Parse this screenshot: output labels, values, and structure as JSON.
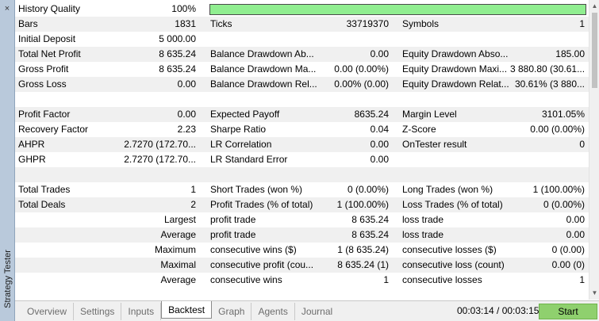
{
  "panel": {
    "title": "Strategy Tester",
    "close_glyph": "×"
  },
  "history_quality": {
    "label": "History Quality",
    "value": "100%",
    "bar_fill_percent": 100,
    "bar_color": "#90ee90"
  },
  "rows": {
    "r1": {
      "c1l": "Bars",
      "c1v": "1831",
      "c2l": "Ticks",
      "c2v": "33719370",
      "c3l": "Symbols",
      "c3v": "1"
    },
    "r2": {
      "c1l": "Initial Deposit",
      "c1v": "5 000.00"
    },
    "r3": {
      "c1l": "Total Net Profit",
      "c1v": "8 635.24",
      "c2l": "Balance Drawdown Ab...",
      "c2v": "0.00",
      "c3l": "Equity Drawdown Abso...",
      "c3v": "185.00"
    },
    "r4": {
      "c1l": "Gross Profit",
      "c1v": "8 635.24",
      "c2l": "Balance Drawdown Ma...",
      "c2v": "0.00 (0.00%)",
      "c3l": "Equity Drawdown Maxi...",
      "c3v": "3 880.80 (30.61..."
    },
    "r5": {
      "c1l": "Gross Loss",
      "c1v": "0.00",
      "c2l": "Balance Drawdown Rel...",
      "c2v": "0.00% (0.00)",
      "c3l": "Equity Drawdown Relat...",
      "c3v": "30.61% (3 880..."
    },
    "r7": {
      "c1l": "Profit Factor",
      "c1v": "0.00",
      "c2l": "Expected Payoff",
      "c2v": "8635.24",
      "c3l": "Margin Level",
      "c3v": "3101.05%"
    },
    "r8": {
      "c1l": "Recovery Factor",
      "c1v": "2.23",
      "c2l": "Sharpe Ratio",
      "c2v": "0.04",
      "c3l": "Z-Score",
      "c3v": "0.00 (0.00%)"
    },
    "r9": {
      "c1l": "AHPR",
      "c1v": "2.7270 (172.70...",
      "c2l": "LR Correlation",
      "c2v": "0.00",
      "c3l": "OnTester result",
      "c3v": "0"
    },
    "r10": {
      "c1l": "GHPR",
      "c1v": "2.7270 (172.70...",
      "c2l": "LR Standard Error",
      "c2v": "0.00"
    },
    "r12": {
      "c1l": "Total Trades",
      "c1v": "1",
      "c2l": "Short Trades (won %)",
      "c2v": "0 (0.00%)",
      "c3l": "Long Trades (won %)",
      "c3v": "1 (100.00%)"
    },
    "r13": {
      "c1l": "Total Deals",
      "c1v": "2",
      "c2l": "Profit Trades (% of total)",
      "c2v": "1 (100.00%)",
      "c3l": "Loss Trades (% of total)",
      "c3v": "0 (0.00%)"
    },
    "r14": {
      "c1r": "Largest",
      "c2l": "profit trade",
      "c2v": "8 635.24",
      "c3l": "loss trade",
      "c3v": "0.00"
    },
    "r15": {
      "c1r": "Average",
      "c2l": "profit trade",
      "c2v": "8 635.24",
      "c3l": "loss trade",
      "c3v": "0.00"
    },
    "r16": {
      "c1r": "Maximum",
      "c2l": "consecutive wins ($)",
      "c2v": "1 (8 635.24)",
      "c3l": "consecutive losses ($)",
      "c3v": "0 (0.00)"
    },
    "r17": {
      "c1r": "Maximal",
      "c2l": "consecutive profit (cou...",
      "c2v": "8 635.24 (1)",
      "c3l": "consecutive loss (count)",
      "c3v": "0.00 (0)"
    },
    "r18": {
      "c1r": "Average",
      "c2l": "consecutive wins",
      "c2v": "1",
      "c3l": "consecutive losses",
      "c3v": "1"
    }
  },
  "tabs": [
    "Overview",
    "Settings",
    "Inputs",
    "Backtest",
    "Graph",
    "Agents",
    "Journal"
  ],
  "active_tab": "Backtest",
  "timer": "00:03:14 / 00:03:15",
  "start_button": "Start",
  "scrollbar": {
    "up_icon": "▲",
    "down_icon": "▼"
  }
}
